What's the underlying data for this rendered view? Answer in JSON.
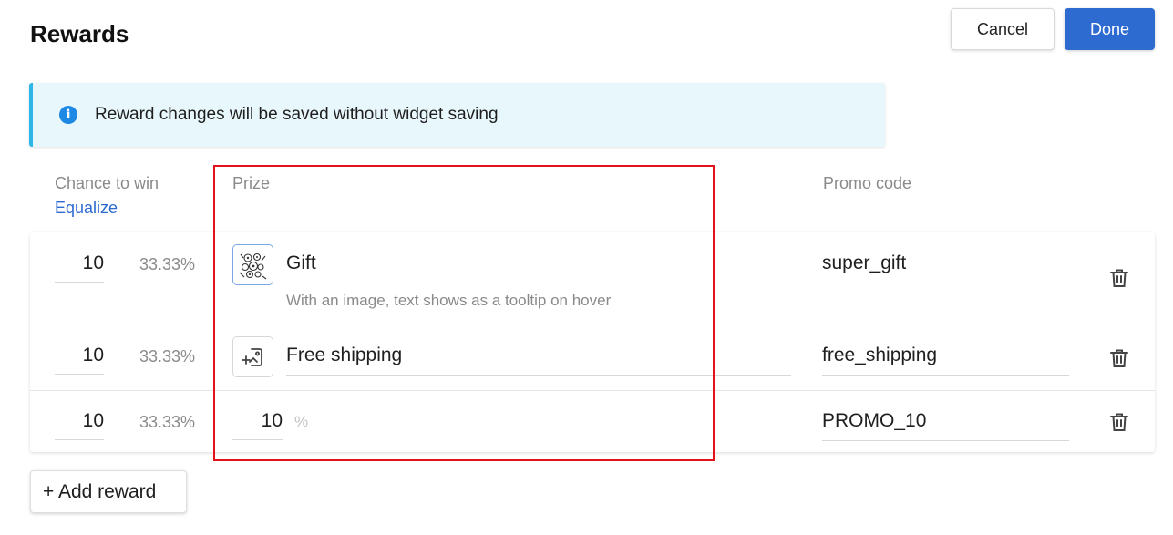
{
  "header": {
    "title": "Rewards",
    "cancel_label": "Cancel",
    "done_label": "Done"
  },
  "banner": {
    "text": "Reward changes will be saved without widget saving",
    "icon": "info-icon",
    "accent": "#2db6e8"
  },
  "columns": {
    "chance": "Chance to win",
    "equalize": "Equalize",
    "prize": "Prize",
    "promo": "Promo code"
  },
  "rewards": [
    {
      "chance": "10",
      "percent": "33.33%",
      "prize": "Gift",
      "hint": "With an image, text shows as a tooltip on hover",
      "promo": "super_gift",
      "thumb": "gift-image"
    },
    {
      "chance": "10",
      "percent": "33.33%",
      "prize": "Free shipping",
      "promo": "free_shipping",
      "thumb": "add-image-icon"
    },
    {
      "chance": "10",
      "percent": "33.33%",
      "discount": "10",
      "unit": "%",
      "promo": "PROMO_10"
    }
  ],
  "footer": {
    "add_label": "+ Add reward"
  },
  "colors": {
    "primary": "#2e6bd1",
    "highlight": "#e3111c"
  }
}
